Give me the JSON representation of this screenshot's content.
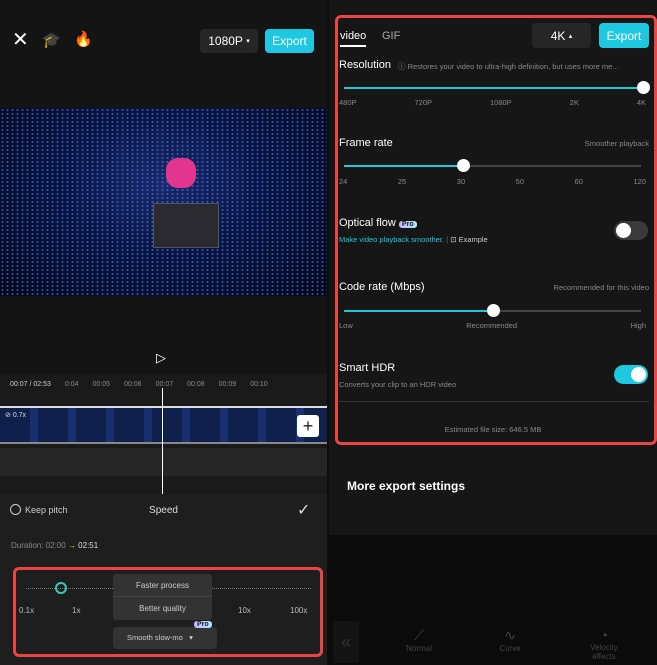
{
  "left": {
    "resolution": "1080P",
    "export": "Export",
    "timeline": {
      "current": "00:07",
      "total": "02:53",
      "marks": [
        "0:04",
        "00:05",
        "00:06",
        "00:07",
        "00:08",
        "00:09",
        "00:10"
      ],
      "clip_speed": "0.7x"
    },
    "speed_panel": {
      "keep_pitch": "Keep pitch",
      "title": "Speed",
      "duration_label": "Duration: 02:00",
      "duration_new": "02:51",
      "scale": [
        "0.1x",
        "1x",
        "10x",
        "100x"
      ],
      "menu": [
        "Faster process",
        "Better quality"
      ],
      "mode": "Smooth slow-mo",
      "pro": "Pro"
    }
  },
  "right": {
    "tabs": [
      "video",
      "GIF"
    ],
    "resolution": "4K",
    "export": "Export",
    "resolution_setting": {
      "label": "Resolution",
      "hint": "Restores your video to ultra-high definition, but uses more me...",
      "ticks": [
        "480P",
        "720P",
        "1080P",
        "2K",
        "4K"
      ],
      "value_fraction": 1.0
    },
    "frame_rate": {
      "label": "Frame rate",
      "hint": "Smoother playback",
      "ticks": [
        "24",
        "25",
        "30",
        "50",
        "60",
        "120"
      ],
      "value": "30"
    },
    "optical_flow": {
      "label": "Optical flow",
      "pro": "Pro",
      "desc": "Make video playback smoother.",
      "example": "Example",
      "enabled": false
    },
    "code_rate": {
      "label": "Code rate (Mbps)",
      "hint": "Recommended for this video",
      "ticks": [
        "Low",
        "Recommended",
        "High"
      ],
      "value_fraction": 0.5
    },
    "smart_hdr": {
      "label": "Smart HDR",
      "desc": "Converts your clip to an HDR video",
      "enabled": true
    },
    "file_size": "Estimated file size: 646.5 MB",
    "more": "More export settings",
    "bottom_nav": [
      "Normal",
      "Curve",
      "Velocity effects"
    ]
  },
  "colors": {
    "accent": "#1ec8e0",
    "highlight": "#e94545"
  }
}
